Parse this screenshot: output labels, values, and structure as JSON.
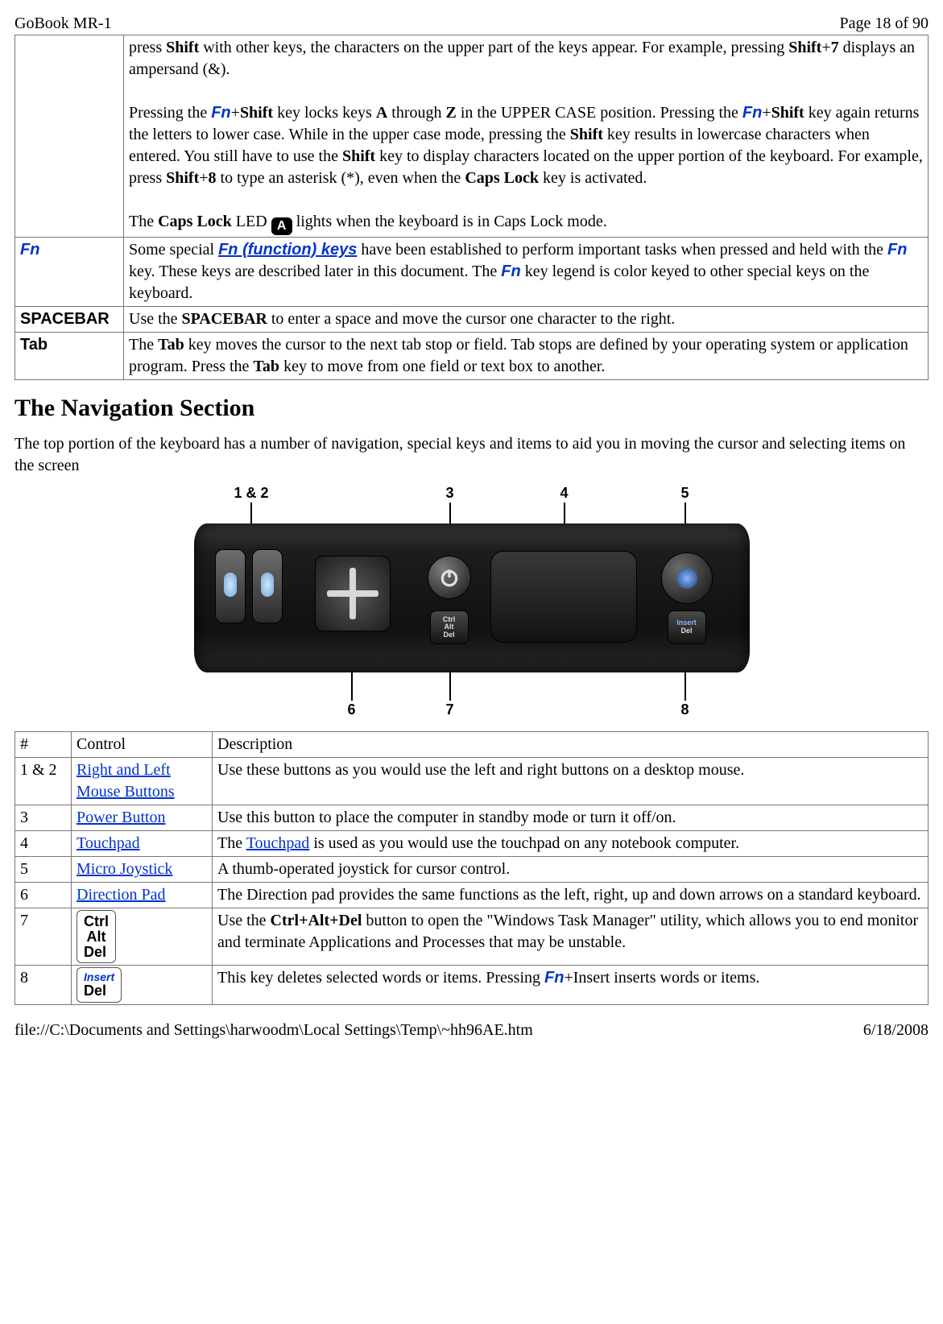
{
  "header": {
    "left": "GoBook MR-1",
    "right": "Page 18 of 90"
  },
  "footer": {
    "left": "file://C:\\Documents and Settings\\harwoodm\\Local Settings\\Temp\\~hh96AE.htm",
    "right": "6/18/2008"
  },
  "key_table": {
    "shift_row": {
      "p1_a": "press ",
      "p1_b": " with other keys, the characters on the upper part of the keys appear. For example, pressing ",
      "p1_c": " displays an ampersand (&).",
      "k1": "Shift",
      "k2": "Shift",
      "k3": "7",
      "p2_a": "Pressing the ",
      "p2_b": " key locks keys ",
      "p2_c": " through ",
      "p2_d": " in the UPPER CASE position. Pressing the ",
      "p2_e": " key again returns the letters to lower case. While in the upper case mode, pressing the ",
      "p2_f": " key results in lowercase characters when entered. You still have to use the ",
      "p2_g": " key to display characters located on the upper portion of the keyboard. For example, press ",
      "p2_h": " to type an asterisk (*), even when the ",
      "p2_i": " key is activated.",
      "k4": "Shift",
      "k5": "A",
      "k6": "Z",
      "k7": "Shift",
      "k8": "Shift",
      "k9": "Shift",
      "k10": "Shift",
      "k11": "8",
      "k12": "Caps Lock",
      "p3_a": "The ",
      "p3_b": " LED ",
      "p3_c": " lights when the keyboard is in Caps Lock mode.",
      "k13": "Caps Lock",
      "icon_a": "A"
    },
    "fn_row": {
      "label": "Fn",
      "t1": "Some special ",
      "link": " (function) keys",
      "t2": " have been established to perform important tasks when pressed and held with the ",
      "t3": " key. These keys are described later in this document.  The ",
      "t4": " key legend is color keyed to other special keys on the keyboard."
    },
    "space_row": {
      "label": "SPACEBAR",
      "t1": "Use the ",
      "k1": "SPACEBAR",
      "t2": " to enter a space and move the cursor one character to the right."
    },
    "tab_row": {
      "label": "Tab",
      "t1": "The ",
      "k1": "Tab",
      "t2": " key moves the cursor to the next tab stop or field. Tab stops are defined by your operating system or application program. Press the ",
      "k2": "Tab",
      "t3": " key to move from one field or text box to another."
    }
  },
  "nav_heading": "The Navigation Section",
  "nav_intro": "The top portion of the keyboard has a number of navigation, special keys and items to aid you in moving the cursor and selecting items on the screen",
  "diagram": {
    "top": {
      "l12": "1 & 2",
      "l3": "3",
      "l4": "4",
      "l5": "5"
    },
    "bottom": {
      "l6": "6",
      "l7": "7",
      "l8": "8"
    }
  },
  "nav_table": {
    "h1": "#",
    "h2": "Control",
    "h3": "Description",
    "r1": {
      "n": "1 & 2",
      "c": "Right and Left Mouse Buttons",
      "d": " Use these buttons as you would use the left and right buttons on a desktop mouse."
    },
    "r2": {
      "n": "3",
      "c": "Power Button",
      "d": "Use this button to place the computer in standby mode or turn it off/on."
    },
    "r3": {
      "n": "4",
      "c": "Touchpad",
      "d_a": "The ",
      "d_link": "Touchpad",
      "d_b": " is used as you would use the touchpad on any notebook computer."
    },
    "r4": {
      "n": "5",
      "c": "Micro Joystick",
      "d": "A thumb-operated joystick for cursor control."
    },
    "r5": {
      "n": "6",
      "c": "Direction Pad",
      "d": "The Direction pad provides the same functions as the left, right, up and down arrows on a standard keyboard."
    },
    "r6": {
      "n": "7",
      "kc_top": "Ctrl",
      "kc_mid": "Alt",
      "kc_bot": "Del",
      "d_a": "Use the ",
      "d_k": "Ctrl+Alt+Del",
      "d_b": " button to open the \"Windows Task Manager\" utility, which allows you to end monitor and terminate Applications and Processes that may be unstable."
    },
    "r7": {
      "n": "8",
      "kc_top": "Insert",
      "kc_bot": "Del",
      "d_a": "This key deletes selected words or items.  Pressing ",
      "d_b": "+Insert inserts words or items."
    }
  },
  "fn_text": "Fn"
}
